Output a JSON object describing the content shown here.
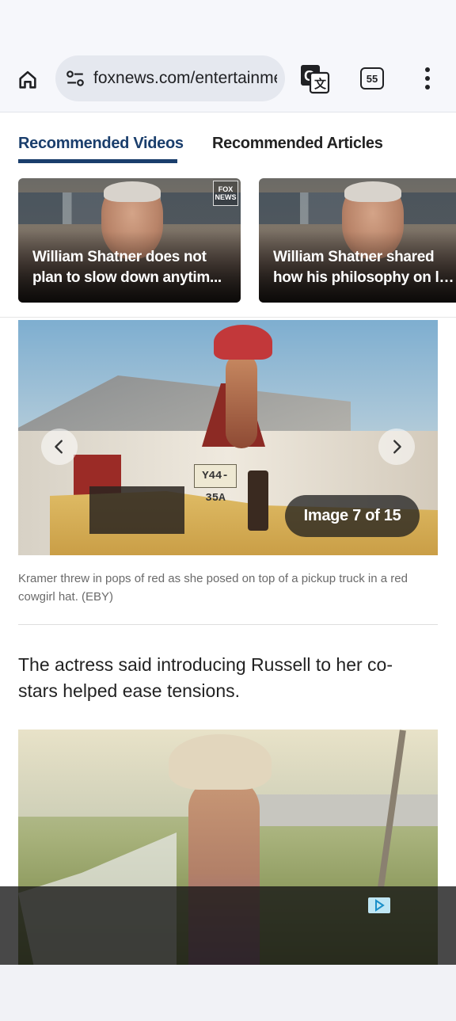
{
  "browser": {
    "url": "foxnews.com/entertainme",
    "tab_count": "55",
    "icons": [
      "home-icon",
      "site-settings-icon",
      "translate-icon",
      "tabs-icon",
      "more-options-icon"
    ]
  },
  "recommended": {
    "tabs": [
      {
        "label": "Recommended Videos",
        "active": true
      },
      {
        "label": "Recommended Articles",
        "active": false
      }
    ],
    "videos": [
      {
        "title_line1": "William Shatner does not",
        "title_line2": "plan to slow down anytim..."
      },
      {
        "title_line1": "William Shatner shared",
        "title_line2": "how his philosophy on lif..."
      }
    ],
    "badge": "FOX NEWS"
  },
  "gallery": {
    "counter": "Image 7 of 15",
    "plate": "Y44-35A",
    "caption": "Kramer threw in pops of red as she posed on top of a pickup truck in a red cowgirl hat. (EBY)"
  },
  "article": {
    "paragraph": "The actress said introducing Russell to her co-stars helped ease tensions."
  },
  "colors": {
    "accent": "#1a3e6c",
    "toolbar_bg": "#f6f7fb",
    "url_pill_bg": "#e5e8ef"
  }
}
